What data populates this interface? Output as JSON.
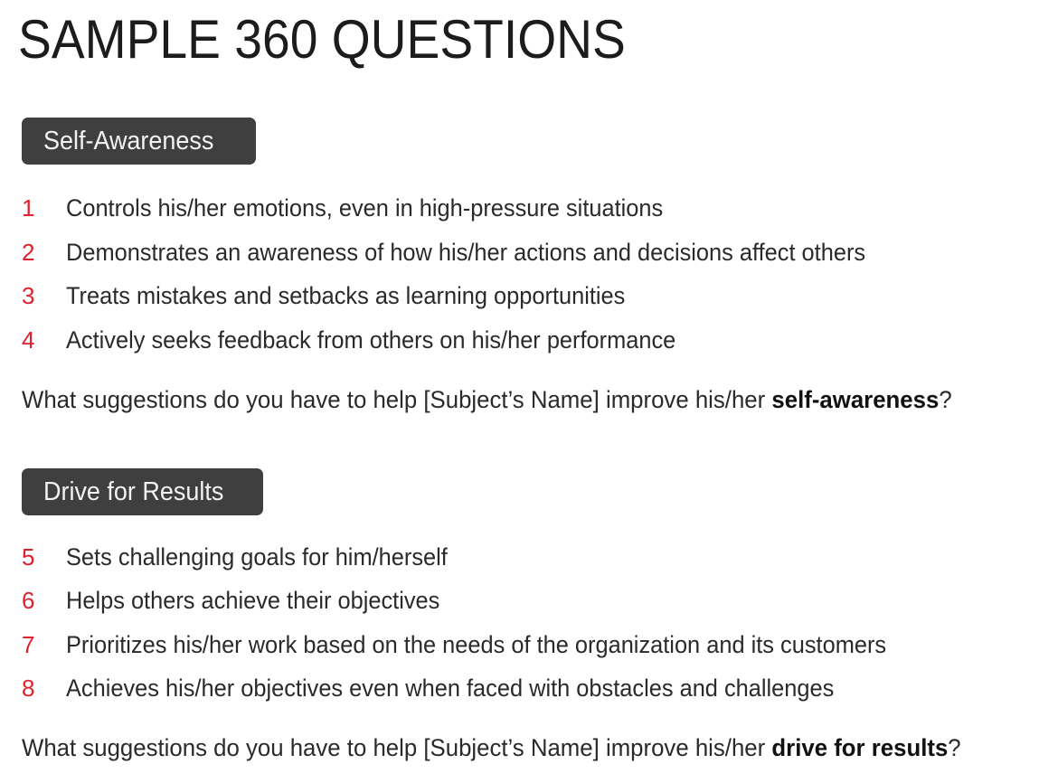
{
  "page": {
    "title": "SAMPLE 360 QUESTIONS",
    "accent_color": "#e0202e",
    "badge_color": "#3f3f3f"
  },
  "sections": [
    {
      "heading": "Self-Awareness",
      "questions": [
        {
          "number": "1",
          "text": "Controls his/her emotions, even in high-pressure situations"
        },
        {
          "number": "2",
          "text": "Demonstrates an awareness of how his/her actions and decisions affect others"
        },
        {
          "number": "3",
          "text": "Treats mistakes and setbacks as learning opportunities"
        },
        {
          "number": "4",
          "text": "Actively seeks feedback from others on his/her performance"
        }
      ],
      "prompt": {
        "before": "What suggestions do you have to help [Subject’s Name] improve his/her ",
        "bold": "self-awareness",
        "after": "?"
      }
    },
    {
      "heading": "Drive for Results",
      "questions": [
        {
          "number": "5",
          "text": "Sets challenging goals for him/herself"
        },
        {
          "number": "6",
          "text": "Helps others achieve their objectives"
        },
        {
          "number": "7",
          "text": "Prioritizes his/her work based on the needs of the organization and its customers"
        },
        {
          "number": "8",
          "text": "Achieves his/her objectives even when faced with obstacles and challenges"
        }
      ],
      "prompt": {
        "before": "What suggestions do you have to help [Subject’s Name] improve his/her ",
        "bold": "drive for results",
        "after": "?"
      }
    }
  ]
}
